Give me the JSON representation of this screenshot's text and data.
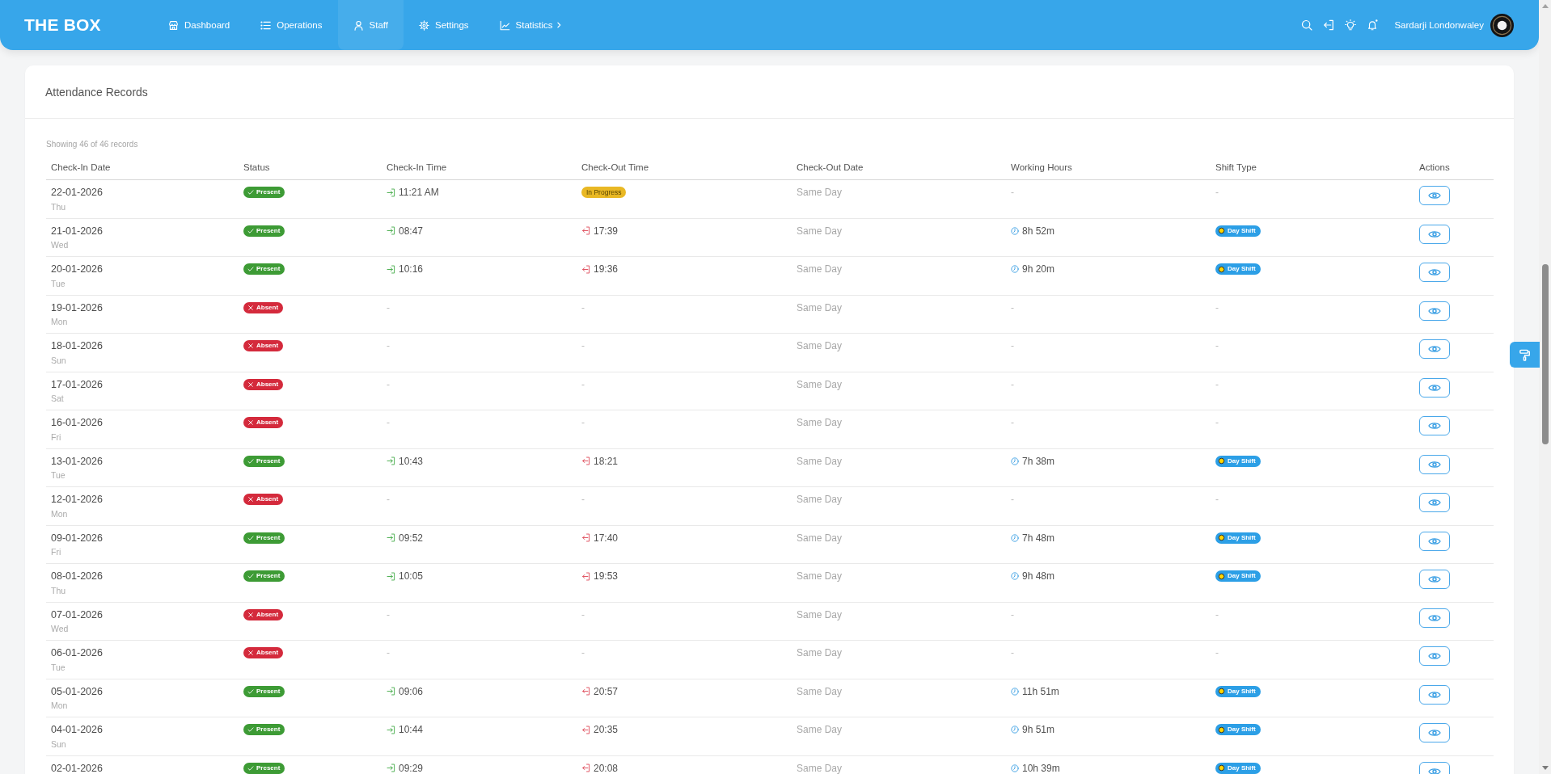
{
  "header": {
    "logo": "THE BOX",
    "nav": [
      {
        "label": "Dashboard",
        "selected": false,
        "submenu": false
      },
      {
        "label": "Operations",
        "selected": false,
        "submenu": false
      },
      {
        "label": "Staff",
        "selected": true,
        "submenu": false
      },
      {
        "label": "Settings",
        "selected": false,
        "submenu": false
      },
      {
        "label": "Statistics",
        "selected": false,
        "submenu": true
      }
    ],
    "alerts": {
      "unread": true
    },
    "user": {
      "name": "Sardarji Londonwaley"
    }
  },
  "card": {
    "title": "Attendance Records",
    "summary": "Showing 46 of 46 records",
    "columns": [
      "Check-In Date",
      "Status",
      "Check-In Time",
      "Check-Out Time",
      "Check-Out Date",
      "Working Hours",
      "Shift Type",
      "Actions"
    ],
    "rows": [
      {
        "date": "22-01-2026",
        "day": "Thu",
        "status": {
          "kind": "present",
          "label": "Present"
        },
        "check_in": {
          "kind": "time",
          "text": "11:21 AM"
        },
        "check_out": {
          "kind": "pending",
          "text": "In Progress"
        },
        "check_out_date": "Same Day",
        "working_hours": {
          "kind": "none",
          "text": "-"
        },
        "shift": {
          "kind": "none",
          "text": "-"
        }
      },
      {
        "date": "21-01-2026",
        "day": "Wed",
        "status": {
          "kind": "present",
          "label": "Present"
        },
        "check_in": {
          "kind": "time",
          "text": "08:47"
        },
        "check_out": {
          "kind": "time",
          "text": "17:39"
        },
        "check_out_date": "Same Day",
        "working_hours": {
          "kind": "duration",
          "text": "8h 52m"
        },
        "shift": {
          "kind": "day",
          "text": "Day Shift"
        }
      },
      {
        "date": "20-01-2026",
        "day": "Tue",
        "status": {
          "kind": "present",
          "label": "Present"
        },
        "check_in": {
          "kind": "time",
          "text": "10:16"
        },
        "check_out": {
          "kind": "time",
          "text": "19:36"
        },
        "check_out_date": "Same Day",
        "working_hours": {
          "kind": "duration",
          "text": "9h 20m"
        },
        "shift": {
          "kind": "day",
          "text": "Day Shift"
        }
      },
      {
        "date": "19-01-2026",
        "day": "Mon",
        "status": {
          "kind": "absent",
          "label": "Absent"
        },
        "check_in": {
          "kind": "none",
          "text": "-"
        },
        "check_out": {
          "kind": "none",
          "text": "-"
        },
        "check_out_date": "Same Day",
        "working_hours": {
          "kind": "none",
          "text": "-"
        },
        "shift": {
          "kind": "none",
          "text": "-"
        }
      },
      {
        "date": "18-01-2026",
        "day": "Sun",
        "status": {
          "kind": "absent",
          "label": "Absent"
        },
        "check_in": {
          "kind": "none",
          "text": "-"
        },
        "check_out": {
          "kind": "none",
          "text": "-"
        },
        "check_out_date": "Same Day",
        "working_hours": {
          "kind": "none",
          "text": "-"
        },
        "shift": {
          "kind": "none",
          "text": "-"
        }
      },
      {
        "date": "17-01-2026",
        "day": "Sat",
        "status": {
          "kind": "absent",
          "label": "Absent"
        },
        "check_in": {
          "kind": "none",
          "text": "-"
        },
        "check_out": {
          "kind": "none",
          "text": "-"
        },
        "check_out_date": "Same Day",
        "working_hours": {
          "kind": "none",
          "text": "-"
        },
        "shift": {
          "kind": "none",
          "text": "-"
        }
      },
      {
        "date": "16-01-2026",
        "day": "Fri",
        "status": {
          "kind": "absent",
          "label": "Absent"
        },
        "check_in": {
          "kind": "none",
          "text": "-"
        },
        "check_out": {
          "kind": "none",
          "text": "-"
        },
        "check_out_date": "Same Day",
        "working_hours": {
          "kind": "none",
          "text": "-"
        },
        "shift": {
          "kind": "none",
          "text": "-"
        }
      },
      {
        "date": "13-01-2026",
        "day": "Tue",
        "status": {
          "kind": "present",
          "label": "Present"
        },
        "check_in": {
          "kind": "time",
          "text": "10:43"
        },
        "check_out": {
          "kind": "time",
          "text": "18:21"
        },
        "check_out_date": "Same Day",
        "working_hours": {
          "kind": "duration",
          "text": "7h 38m"
        },
        "shift": {
          "kind": "day",
          "text": "Day Shift"
        }
      },
      {
        "date": "12-01-2026",
        "day": "Mon",
        "status": {
          "kind": "absent",
          "label": "Absent"
        },
        "check_in": {
          "kind": "none",
          "text": "-"
        },
        "check_out": {
          "kind": "none",
          "text": "-"
        },
        "check_out_date": "Same Day",
        "working_hours": {
          "kind": "none",
          "text": "-"
        },
        "shift": {
          "kind": "none",
          "text": "-"
        }
      },
      {
        "date": "09-01-2026",
        "day": "Fri",
        "status": {
          "kind": "present",
          "label": "Present"
        },
        "check_in": {
          "kind": "time",
          "text": "09:52"
        },
        "check_out": {
          "kind": "time",
          "text": "17:40"
        },
        "check_out_date": "Same Day",
        "working_hours": {
          "kind": "duration",
          "text": "7h 48m"
        },
        "shift": {
          "kind": "day",
          "text": "Day Shift"
        }
      },
      {
        "date": "08-01-2026",
        "day": "Thu",
        "status": {
          "kind": "present",
          "label": "Present"
        },
        "check_in": {
          "kind": "time",
          "text": "10:05"
        },
        "check_out": {
          "kind": "time",
          "text": "19:53"
        },
        "check_out_date": "Same Day",
        "working_hours": {
          "kind": "duration",
          "text": "9h 48m"
        },
        "shift": {
          "kind": "day",
          "text": "Day Shift"
        }
      },
      {
        "date": "07-01-2026",
        "day": "Wed",
        "status": {
          "kind": "absent",
          "label": "Absent"
        },
        "check_in": {
          "kind": "none",
          "text": "-"
        },
        "check_out": {
          "kind": "none",
          "text": "-"
        },
        "check_out_date": "Same Day",
        "working_hours": {
          "kind": "none",
          "text": "-"
        },
        "shift": {
          "kind": "none",
          "text": "-"
        }
      },
      {
        "date": "06-01-2026",
        "day": "Tue",
        "status": {
          "kind": "absent",
          "label": "Absent"
        },
        "check_in": {
          "kind": "none",
          "text": "-"
        },
        "check_out": {
          "kind": "none",
          "text": "-"
        },
        "check_out_date": "Same Day",
        "working_hours": {
          "kind": "none",
          "text": "-"
        },
        "shift": {
          "kind": "none",
          "text": "-"
        }
      },
      {
        "date": "05-01-2026",
        "day": "Mon",
        "status": {
          "kind": "present",
          "label": "Present"
        },
        "check_in": {
          "kind": "time",
          "text": "09:06"
        },
        "check_out": {
          "kind": "time",
          "text": "20:57"
        },
        "check_out_date": "Same Day",
        "working_hours": {
          "kind": "duration",
          "text": "11h 51m"
        },
        "shift": {
          "kind": "day",
          "text": "Day Shift"
        }
      },
      {
        "date": "04-01-2026",
        "day": "Sun",
        "status": {
          "kind": "present",
          "label": "Present"
        },
        "check_in": {
          "kind": "time",
          "text": "10:44"
        },
        "check_out": {
          "kind": "time",
          "text": "20:35"
        },
        "check_out_date": "Same Day",
        "working_hours": {
          "kind": "duration",
          "text": "9h 51m"
        },
        "shift": {
          "kind": "day",
          "text": "Day Shift"
        }
      },
      {
        "date": "02-01-2026",
        "status": {
          "kind": "present",
          "label": "Present"
        },
        "check_in": {
          "kind": "time",
          "text": "09:29"
        },
        "check_out": {
          "kind": "time",
          "text": "20:08"
        },
        "check_out_date": "Same Day",
        "working_hours": {
          "kind": "duration",
          "text": "10h 39m"
        },
        "shift": {
          "kind": "day",
          "text": "Day Shift"
        }
      }
    ]
  }
}
